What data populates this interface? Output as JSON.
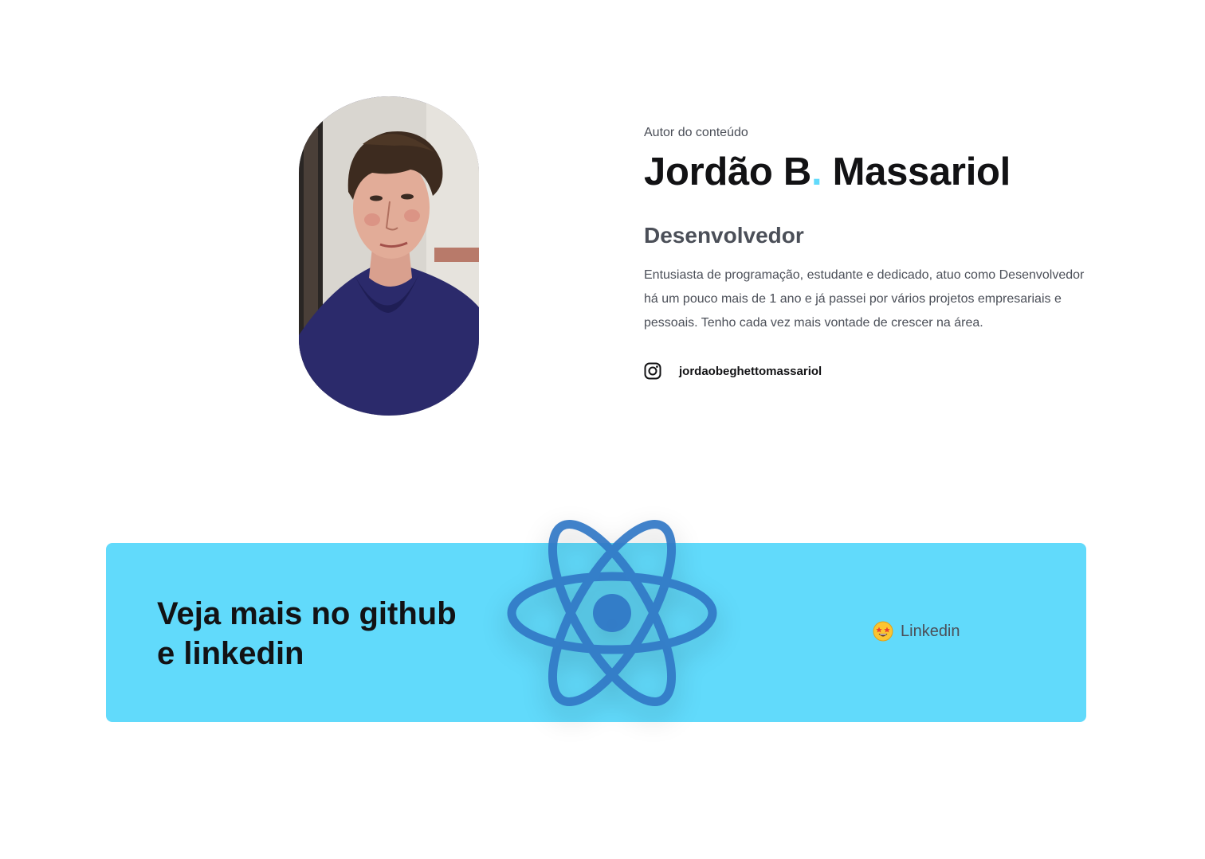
{
  "author": {
    "eyebrow": "Autor do conteúdo",
    "name_first": "Jordão B",
    "name_dot": ".",
    "name_last": " Massariol",
    "role": "Desenvolvedor",
    "bio": "Entusiasta de programação, estudante e dedicado, atuo como Desenvolvedor há um pouco mais de 1 ano e já passei por vários projetos empresariais e pessoais. Tenho cada vez mais vontade de crescer na área.",
    "social": {
      "icon": "instagram-icon",
      "handle": "jordaobeghettomassariol"
    },
    "photo_alt": "Foto do autor"
  },
  "banner": {
    "title_line1": "Veja mais no github",
    "title_line2": "e linkedin",
    "logo_icon": "react-logo-icon",
    "link_emoji": "star-struck-emoji-icon",
    "link_label": "Linkedin"
  },
  "colors": {
    "accent": "#61dafb",
    "heading": "#121214",
    "text": "#4b4f58",
    "react_blue": "#3178c6"
  }
}
